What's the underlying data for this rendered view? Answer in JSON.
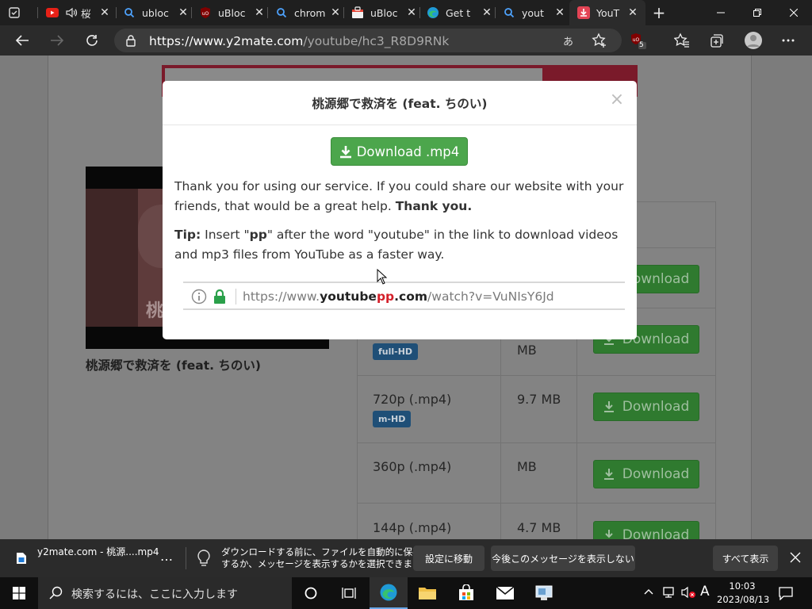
{
  "browser": {
    "tabs": [
      {
        "title": "",
        "icon": "tab-actions-icon"
      },
      {
        "title": "桜",
        "icon": "youtube-icon",
        "audio": true
      },
      {
        "title": "ubloc",
        "icon": "search-icon"
      },
      {
        "title": "uBloc",
        "icon": "ublock-icon"
      },
      {
        "title": "chrom",
        "icon": "search-icon"
      },
      {
        "title": "uBloc",
        "icon": "store-icon"
      },
      {
        "title": "Get t",
        "icon": "edge-icon"
      },
      {
        "title": "yout",
        "icon": "search-icon"
      },
      {
        "title": "YouT",
        "icon": "y2mate-icon",
        "active": true
      }
    ],
    "url_host": "https://www.y2mate.com",
    "url_path": "/youtube/hc3_R8D9RNk",
    "extension_badge": "5"
  },
  "page": {
    "video_title": "桃源郷で救済を (feat. ちのい)",
    "rows": [
      {
        "quality": "",
        "badge": "",
        "size": "",
        "button": "Download"
      },
      {
        "quality": "",
        "badge": "full-HD",
        "size": "MB",
        "button": "Download"
      },
      {
        "quality": "720p (.mp4)",
        "badge": "m-HD",
        "size": "9.7 MB",
        "button": "Download"
      },
      {
        "quality": "360p (.mp4)",
        "badge": "",
        "size": "MB",
        "button": "Download"
      },
      {
        "quality": "144p (.mp4)",
        "badge": "",
        "size": "4.7 MB",
        "button": "Download"
      }
    ]
  },
  "modal": {
    "title": "桃源郷で救済を (feat. ちのい)",
    "download_label": "Download .mp4",
    "thanks_text": "Thank you for using our service. If you could share our website with your friends, that would be a great help.",
    "thanks_bold": "Thank you.",
    "tip_label": "Tip:",
    "tip_text_1": "Insert \"",
    "tip_pp": "pp",
    "tip_text_2": "\" after the word \"youtube\" in the link to download videos and mp3 files from YouTube as a faster way.",
    "demo_url": {
      "prefix": "https://www.",
      "youtube": "youtube",
      "pp": "pp",
      "com": ".com",
      "rest": "/watch?v=VuNIsY6Jd"
    },
    "close_symbol": "×"
  },
  "download_bar": {
    "file_name": "y2mate.com - 桃源....mp4",
    "more": "…",
    "message_line1": "ダウンロードする前に、ファイルを自動的に保存",
    "message_line2": "するか、メッセージを表示するかを選択できます。",
    "settings_button": "設定に移動",
    "dismiss_button": "今後このメッセージを表示しない",
    "show_all_button": "すべて表示"
  },
  "taskbar": {
    "search_placeholder": "検索するには、ここに入力します",
    "ime": "A",
    "time": "10:03",
    "date": "2023/08/13"
  },
  "colors": {
    "accent_green": "#4ca64c",
    "badge_blue": "#1f4f77",
    "brand_red": "#d4202a"
  }
}
